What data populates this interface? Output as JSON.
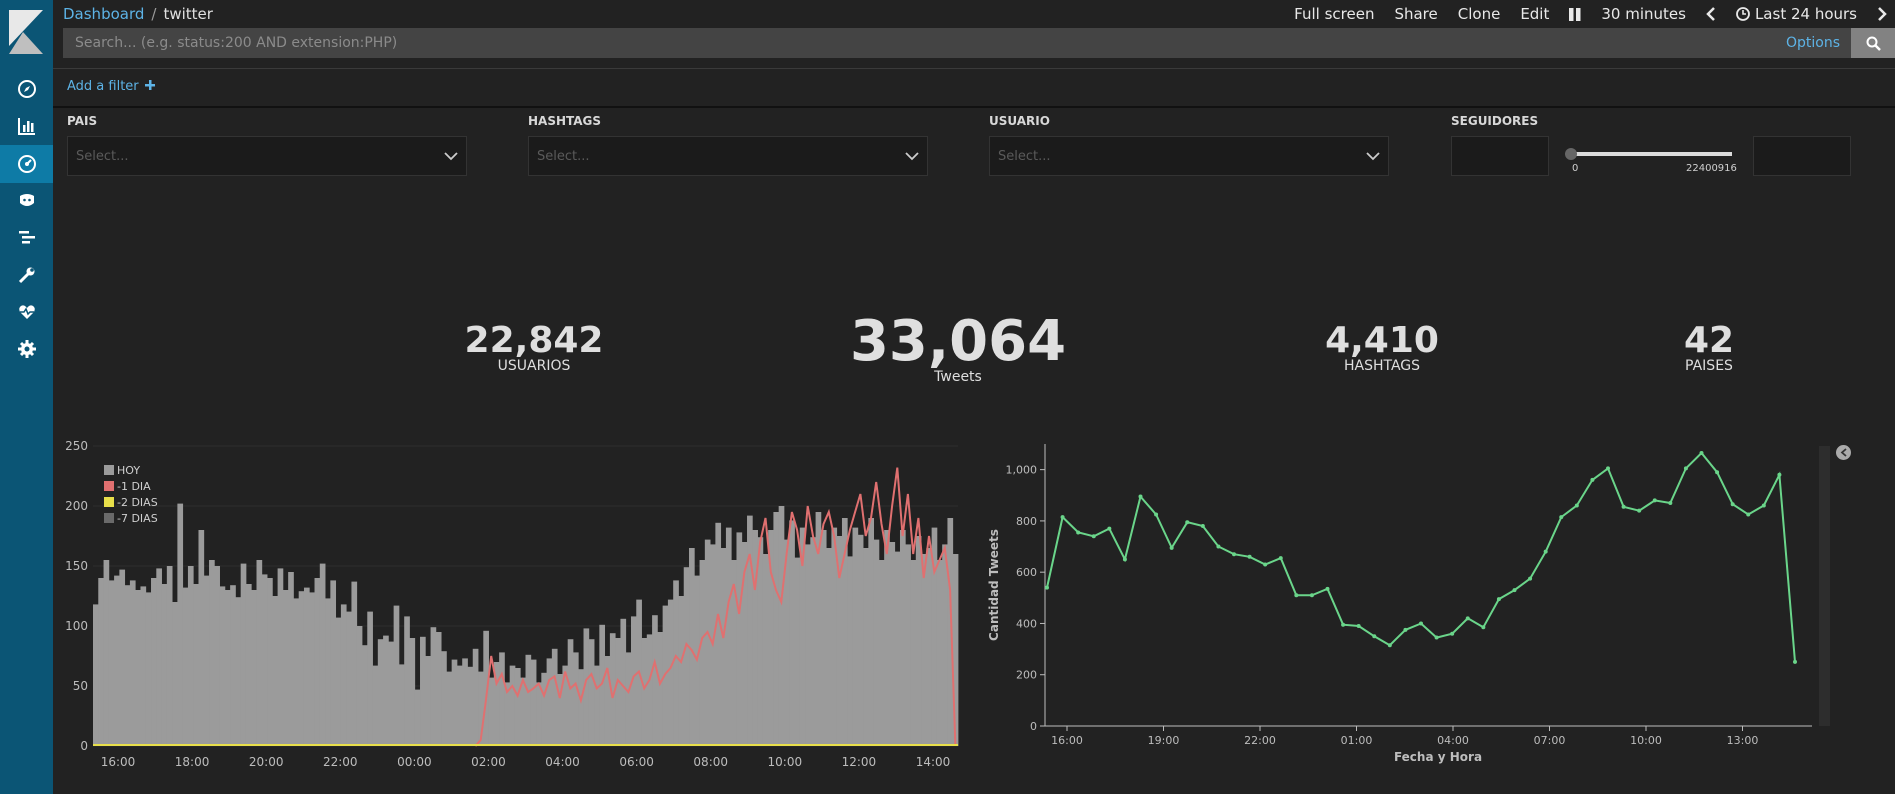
{
  "breadcrumb": {
    "root": "Dashboard",
    "separator": "/",
    "current": "twitter"
  },
  "top_actions": {
    "full_screen": "Full screen",
    "share": "Share",
    "clone": "Clone",
    "edit": "Edit",
    "interval": "30 minutes",
    "time_range": "Last 24 hours"
  },
  "search": {
    "placeholder": "Search... (e.g. status:200 AND extension:PHP)",
    "options": "Options"
  },
  "filter": {
    "add_label": "Add a filter"
  },
  "controls": {
    "pais": {
      "label": "PAIS",
      "placeholder": "Select..."
    },
    "hashtags": {
      "label": "HASHTAGS",
      "placeholder": "Select..."
    },
    "usuario": {
      "label": "USUARIO",
      "placeholder": "Select..."
    },
    "seguidores": {
      "label": "SEGUIDORES",
      "min": "0",
      "max": "22400916"
    }
  },
  "metrics": [
    {
      "value": "22,842",
      "label": "USUARIOS"
    },
    {
      "value": "33,064",
      "label": "Tweets"
    },
    {
      "value": "4,410",
      "label": "HASHTAGS"
    },
    {
      "value": "42",
      "label": "PAISES"
    }
  ],
  "sidebar_icons": [
    "kibana-logo",
    "compass-icon",
    "bar-chart-icon",
    "dashboard-icon",
    "timelion-icon",
    "dev-tools-icon",
    "wrench-icon",
    "heartbeat-icon",
    "gear-icon"
  ],
  "colors": {
    "sidebar": "#0b5575",
    "sidebar_active": "#0e7ba6",
    "accent": "#5db3e6",
    "hoy": "#9b9b9b",
    "dia1": "#e07070",
    "dia2": "#e8df4a",
    "dia7": "#6a6a6a",
    "line": "#6ad58a"
  },
  "chart_data": [
    {
      "type": "bar",
      "legend": [
        "HOY",
        "-1 DIA",
        "-2 DIAS",
        "-7 DIAS"
      ],
      "x_ticks": [
        "16:00",
        "18:00",
        "20:00",
        "22:00",
        "00:00",
        "02:00",
        "04:00",
        "06:00",
        "08:00",
        "10:00",
        "12:00",
        "14:00"
      ],
      "y_ticks": [
        0,
        50,
        100,
        150,
        200,
        250
      ],
      "ylim": [
        0,
        250
      ],
      "series": [
        {
          "name": "HOY",
          "values": [
            118,
            140,
            155,
            138,
            142,
            147,
            134,
            138,
            130,
            133,
            128,
            140,
            148,
            135,
            150,
            120,
            202,
            132,
            150,
            135,
            180,
            142,
            155,
            150,
            133,
            130,
            134,
            124,
            152,
            135,
            130,
            155,
            143,
            140,
            125,
            148,
            130,
            145,
            123,
            129,
            132,
            128,
            140,
            152,
            123,
            138,
            107,
            118,
            112,
            137,
            100,
            84,
            112,
            67,
            89,
            92,
            87,
            117,
            68,
            108,
            90,
            47,
            91,
            75,
            99,
            95,
            79,
            62,
            72,
            67,
            73,
            66,
            81,
            62,
            96,
            57,
            70,
            78,
            53,
            67,
            65,
            57,
            76,
            72,
            53,
            61,
            73,
            81,
            60,
            67,
            89,
            78,
            64,
            98,
            89,
            67,
            101,
            75,
            94,
            90,
            106,
            78,
            108,
            122,
            90,
            93,
            109,
            95,
            117,
            122,
            138,
            125,
            149,
            165,
            142,
            155,
            172,
            168,
            186,
            165,
            182,
            155,
            178,
            170,
            192,
            180,
            174,
            160,
            180,
            195,
            200,
            172,
            188,
            157,
            182,
            168,
            174,
            195,
            180,
            165,
            182,
            175,
            190,
            158,
            182,
            176,
            165,
            190,
            172,
            155,
            180,
            170,
            162,
            180,
            168,
            155,
            175,
            160,
            165,
            182,
            155,
            168,
            190,
            160
          ]
        },
        {
          "name": "-1 DIA",
          "values": [
            0,
            0,
            0,
            0,
            0,
            0,
            0,
            0,
            0,
            0,
            0,
            0,
            0,
            0,
            0,
            0,
            0,
            0,
            0,
            0,
            0,
            0,
            0,
            0,
            0,
            0,
            0,
            0,
            0,
            0,
            0,
            0,
            0,
            0,
            0,
            0,
            0,
            0,
            0,
            0,
            0,
            0,
            0,
            0,
            0,
            0,
            0,
            0,
            0,
            0,
            0,
            0,
            0,
            0,
            0,
            0,
            0,
            0,
            0,
            0,
            0,
            0,
            0,
            0,
            0,
            0,
            0,
            0,
            0,
            0,
            0,
            0,
            0,
            5,
            38,
            75,
            52,
            60,
            45,
            50,
            42,
            55,
            45,
            48,
            52,
            42,
            55,
            58,
            40,
            62,
            48,
            52,
            38,
            55,
            60,
            48,
            52,
            65,
            40,
            55,
            50,
            45,
            58,
            62,
            48,
            55,
            70,
            52,
            60,
            65,
            75,
            70,
            85,
            80,
            72,
            90,
            95,
            85,
            110,
            90,
            120,
            135,
            110,
            145,
            160,
            130,
            170,
            190,
            145,
            130,
            120,
            160,
            195,
            180,
            150,
            200,
            175,
            160,
            185,
            195,
            175,
            140,
            160,
            180,
            195,
            210,
            175,
            190,
            220,
            185,
            160,
            200,
            232,
            175,
            210,
            160,
            190,
            140,
            175,
            145,
            155,
            165,
            130,
            0
          ]
        },
        {
          "name": "-2 DIAS",
          "values": []
        },
        {
          "name": "-7 DIAS",
          "values": []
        }
      ]
    },
    {
      "type": "line",
      "xlabel": "Fecha y Hora",
      "ylabel": "Cantidad Tweets",
      "x_ticks": [
        "16:00",
        "19:00",
        "22:00",
        "01:00",
        "04:00",
        "07:00",
        "10:00",
        "13:00"
      ],
      "y_ticks": [
        0,
        200,
        400,
        600,
        800,
        1000
      ],
      "ylim": [
        0,
        1100
      ],
      "series": [
        {
          "name": "Tweets",
          "values": [
            540,
            815,
            755,
            740,
            770,
            650,
            895,
            825,
            695,
            795,
            780,
            700,
            670,
            660,
            630,
            655,
            510,
            510,
            535,
            395,
            390,
            350,
            315,
            375,
            400,
            345,
            360,
            420,
            385,
            495,
            530,
            575,
            680,
            815,
            860,
            960,
            1005,
            855,
            840,
            880,
            870,
            1005,
            1065,
            990,
            865,
            825,
            860,
            980,
            250
          ]
        }
      ]
    }
  ]
}
